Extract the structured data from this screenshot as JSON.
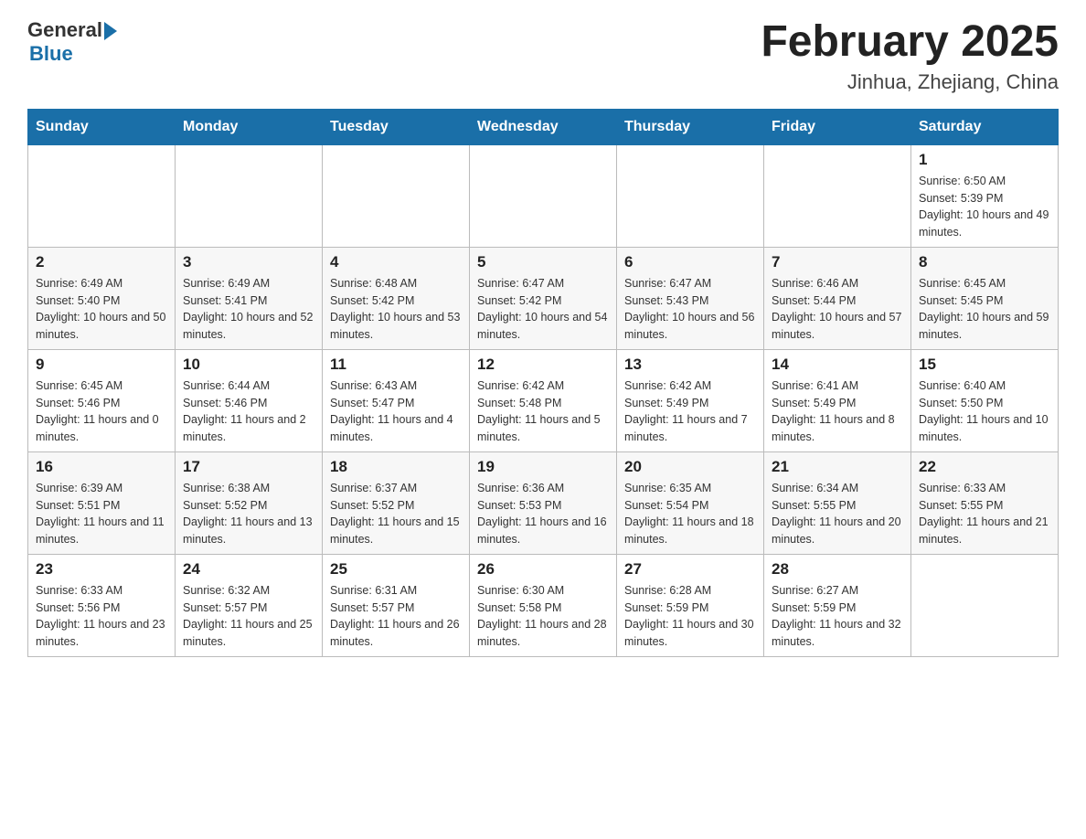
{
  "logo": {
    "general": "General",
    "blue": "Blue"
  },
  "title": "February 2025",
  "location": "Jinhua, Zhejiang, China",
  "days_of_week": [
    "Sunday",
    "Monday",
    "Tuesday",
    "Wednesday",
    "Thursday",
    "Friday",
    "Saturday"
  ],
  "weeks": [
    [
      null,
      null,
      null,
      null,
      null,
      null,
      {
        "day": "1",
        "sunrise": "Sunrise: 6:50 AM",
        "sunset": "Sunset: 5:39 PM",
        "daylight": "Daylight: 10 hours and 49 minutes."
      }
    ],
    [
      {
        "day": "2",
        "sunrise": "Sunrise: 6:49 AM",
        "sunset": "Sunset: 5:40 PM",
        "daylight": "Daylight: 10 hours and 50 minutes."
      },
      {
        "day": "3",
        "sunrise": "Sunrise: 6:49 AM",
        "sunset": "Sunset: 5:41 PM",
        "daylight": "Daylight: 10 hours and 52 minutes."
      },
      {
        "day": "4",
        "sunrise": "Sunrise: 6:48 AM",
        "sunset": "Sunset: 5:42 PM",
        "daylight": "Daylight: 10 hours and 53 minutes."
      },
      {
        "day": "5",
        "sunrise": "Sunrise: 6:47 AM",
        "sunset": "Sunset: 5:42 PM",
        "daylight": "Daylight: 10 hours and 54 minutes."
      },
      {
        "day": "6",
        "sunrise": "Sunrise: 6:47 AM",
        "sunset": "Sunset: 5:43 PM",
        "daylight": "Daylight: 10 hours and 56 minutes."
      },
      {
        "day": "7",
        "sunrise": "Sunrise: 6:46 AM",
        "sunset": "Sunset: 5:44 PM",
        "daylight": "Daylight: 10 hours and 57 minutes."
      },
      {
        "day": "8",
        "sunrise": "Sunrise: 6:45 AM",
        "sunset": "Sunset: 5:45 PM",
        "daylight": "Daylight: 10 hours and 59 minutes."
      }
    ],
    [
      {
        "day": "9",
        "sunrise": "Sunrise: 6:45 AM",
        "sunset": "Sunset: 5:46 PM",
        "daylight": "Daylight: 11 hours and 0 minutes."
      },
      {
        "day": "10",
        "sunrise": "Sunrise: 6:44 AM",
        "sunset": "Sunset: 5:46 PM",
        "daylight": "Daylight: 11 hours and 2 minutes."
      },
      {
        "day": "11",
        "sunrise": "Sunrise: 6:43 AM",
        "sunset": "Sunset: 5:47 PM",
        "daylight": "Daylight: 11 hours and 4 minutes."
      },
      {
        "day": "12",
        "sunrise": "Sunrise: 6:42 AM",
        "sunset": "Sunset: 5:48 PM",
        "daylight": "Daylight: 11 hours and 5 minutes."
      },
      {
        "day": "13",
        "sunrise": "Sunrise: 6:42 AM",
        "sunset": "Sunset: 5:49 PM",
        "daylight": "Daylight: 11 hours and 7 minutes."
      },
      {
        "day": "14",
        "sunrise": "Sunrise: 6:41 AM",
        "sunset": "Sunset: 5:49 PM",
        "daylight": "Daylight: 11 hours and 8 minutes."
      },
      {
        "day": "15",
        "sunrise": "Sunrise: 6:40 AM",
        "sunset": "Sunset: 5:50 PM",
        "daylight": "Daylight: 11 hours and 10 minutes."
      }
    ],
    [
      {
        "day": "16",
        "sunrise": "Sunrise: 6:39 AM",
        "sunset": "Sunset: 5:51 PM",
        "daylight": "Daylight: 11 hours and 11 minutes."
      },
      {
        "day": "17",
        "sunrise": "Sunrise: 6:38 AM",
        "sunset": "Sunset: 5:52 PM",
        "daylight": "Daylight: 11 hours and 13 minutes."
      },
      {
        "day": "18",
        "sunrise": "Sunrise: 6:37 AM",
        "sunset": "Sunset: 5:52 PM",
        "daylight": "Daylight: 11 hours and 15 minutes."
      },
      {
        "day": "19",
        "sunrise": "Sunrise: 6:36 AM",
        "sunset": "Sunset: 5:53 PM",
        "daylight": "Daylight: 11 hours and 16 minutes."
      },
      {
        "day": "20",
        "sunrise": "Sunrise: 6:35 AM",
        "sunset": "Sunset: 5:54 PM",
        "daylight": "Daylight: 11 hours and 18 minutes."
      },
      {
        "day": "21",
        "sunrise": "Sunrise: 6:34 AM",
        "sunset": "Sunset: 5:55 PM",
        "daylight": "Daylight: 11 hours and 20 minutes."
      },
      {
        "day": "22",
        "sunrise": "Sunrise: 6:33 AM",
        "sunset": "Sunset: 5:55 PM",
        "daylight": "Daylight: 11 hours and 21 minutes."
      }
    ],
    [
      {
        "day": "23",
        "sunrise": "Sunrise: 6:33 AM",
        "sunset": "Sunset: 5:56 PM",
        "daylight": "Daylight: 11 hours and 23 minutes."
      },
      {
        "day": "24",
        "sunrise": "Sunrise: 6:32 AM",
        "sunset": "Sunset: 5:57 PM",
        "daylight": "Daylight: 11 hours and 25 minutes."
      },
      {
        "day": "25",
        "sunrise": "Sunrise: 6:31 AM",
        "sunset": "Sunset: 5:57 PM",
        "daylight": "Daylight: 11 hours and 26 minutes."
      },
      {
        "day": "26",
        "sunrise": "Sunrise: 6:30 AM",
        "sunset": "Sunset: 5:58 PM",
        "daylight": "Daylight: 11 hours and 28 minutes."
      },
      {
        "day": "27",
        "sunrise": "Sunrise: 6:28 AM",
        "sunset": "Sunset: 5:59 PM",
        "daylight": "Daylight: 11 hours and 30 minutes."
      },
      {
        "day": "28",
        "sunrise": "Sunrise: 6:27 AM",
        "sunset": "Sunset: 5:59 PM",
        "daylight": "Daylight: 11 hours and 32 minutes."
      },
      null
    ]
  ]
}
